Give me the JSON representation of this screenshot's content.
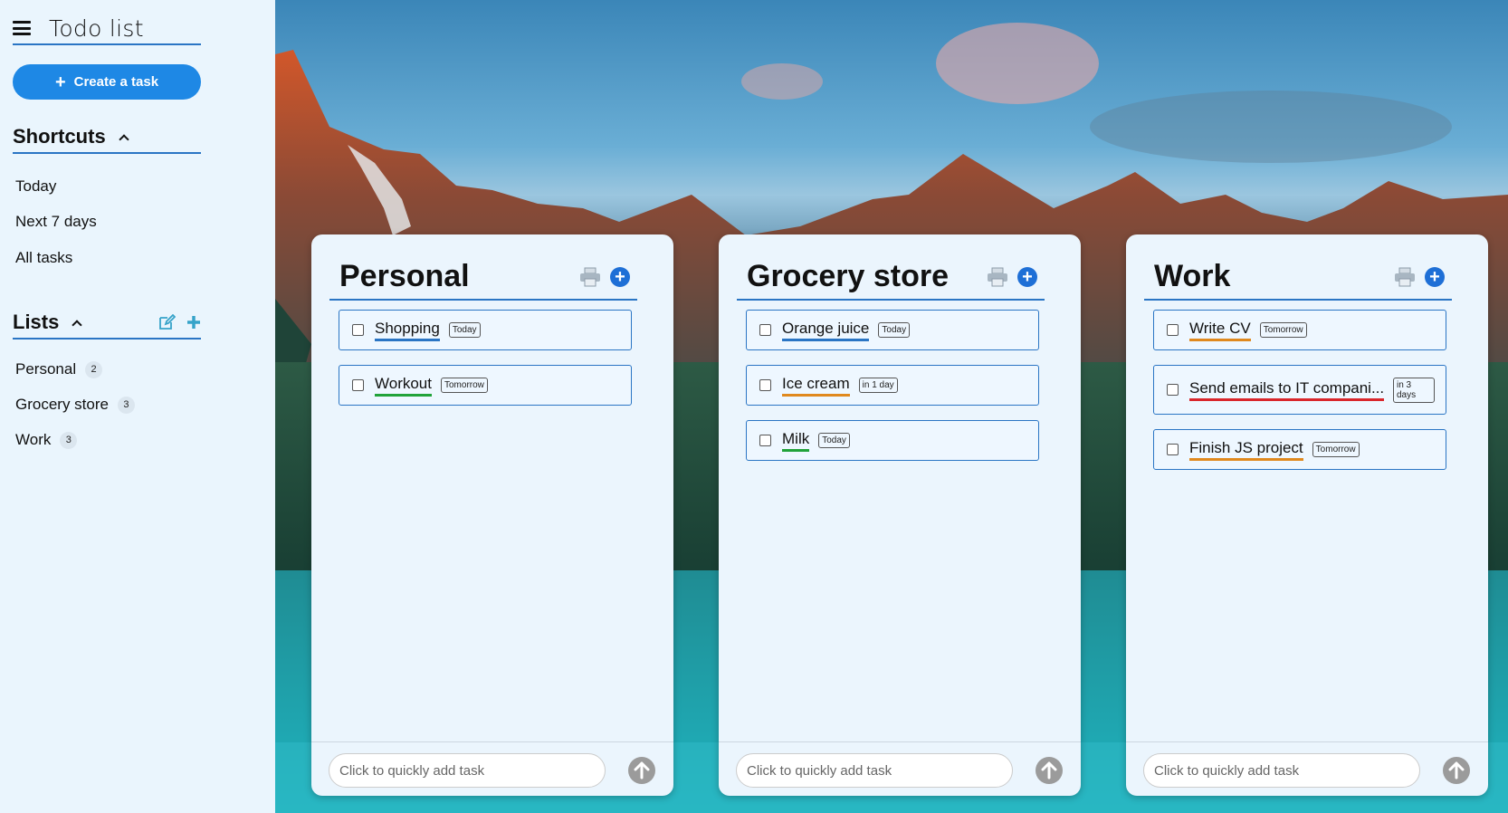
{
  "app": {
    "title": "Todo list",
    "create_label": "Create a task"
  },
  "shortcuts": {
    "title": "Shortcuts",
    "items": [
      {
        "label": "Today"
      },
      {
        "label": "Next 7 days"
      },
      {
        "label": "All tasks"
      }
    ]
  },
  "lists": {
    "title": "Lists",
    "items": [
      {
        "label": "Personal",
        "count": "2"
      },
      {
        "label": "Grocery store",
        "count": "3"
      },
      {
        "label": "Work",
        "count": "3"
      }
    ]
  },
  "quick_add_placeholder": "Click to quickly add task",
  "colors": {
    "accent": "#1e88e5",
    "divider": "#2a75c4",
    "priority_blue": "#2a75c4",
    "priority_green": "#21a33a",
    "priority_orange": "#e0891e",
    "priority_red": "#d9262b"
  },
  "cards": [
    {
      "title": "Personal",
      "tasks": [
        {
          "name": "Shopping",
          "due": "Today",
          "priority_color": "#2a75c4"
        },
        {
          "name": "Workout",
          "due": "Tomorrow",
          "priority_color": "#21a33a"
        }
      ]
    },
    {
      "title": "Grocery store",
      "tasks": [
        {
          "name": "Orange juice",
          "due": "Today",
          "priority_color": "#2a75c4"
        },
        {
          "name": "Ice cream",
          "due": "in 1 day",
          "priority_color": "#e0891e"
        },
        {
          "name": "Milk",
          "due": "Today",
          "priority_color": "#21a33a"
        }
      ]
    },
    {
      "title": "Work",
      "tasks": [
        {
          "name": "Write CV",
          "due": "Tomorrow",
          "priority_color": "#e0891e"
        },
        {
          "name": "Send emails to IT compani...",
          "due": "in 3 days",
          "priority_color": "#d9262b"
        },
        {
          "name": "Finish JS project",
          "due": "Tomorrow",
          "priority_color": "#e0891e"
        }
      ]
    }
  ]
}
